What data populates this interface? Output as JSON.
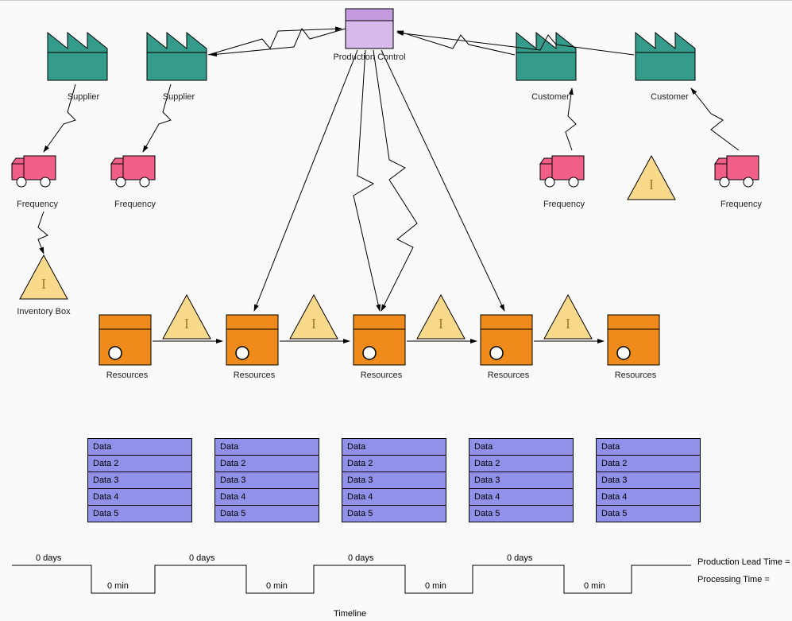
{
  "production_control_label": "Production Control",
  "suppliers": [
    {
      "label": "Supplier"
    },
    {
      "label": "Supplier"
    }
  ],
  "customers": [
    {
      "label": "Customer"
    },
    {
      "label": "Customer"
    }
  ],
  "trucks": [
    {
      "label": "Frequency"
    },
    {
      "label": "Frequency"
    },
    {
      "label": "Frequency"
    },
    {
      "label": "Frequency"
    }
  ],
  "inventory_box_label": "Inventory Box",
  "resources": [
    {
      "label": "Resources"
    },
    {
      "label": "Resources"
    },
    {
      "label": "Resources"
    },
    {
      "label": "Resources"
    },
    {
      "label": "Resources"
    }
  ],
  "data_boxes": [
    [
      "Data",
      "Data 2",
      "Data 3",
      "Data 4",
      "Data 5"
    ],
    [
      "Data",
      "Data 2",
      "Data 3",
      "Data 4",
      "Data 5"
    ],
    [
      "Data",
      "Data 2",
      "Data 3",
      "Data 4",
      "Data 5"
    ],
    [
      "Data",
      "Data 2",
      "Data 3",
      "Data 4",
      "Data 5"
    ],
    [
      "Data",
      "Data 2",
      "Data 3",
      "Data 4",
      "Data 5"
    ]
  ],
  "timeline": {
    "top_labels": [
      "0 days",
      "0 days",
      "0 days",
      "0 days"
    ],
    "bottom_labels": [
      "0 min",
      "0 min",
      "0 min",
      "0 min"
    ],
    "caption": "Timeline",
    "lead_time_label": "Production Lead Time =",
    "processing_time_label": "Processing Time ="
  },
  "inventory_letter": "I"
}
